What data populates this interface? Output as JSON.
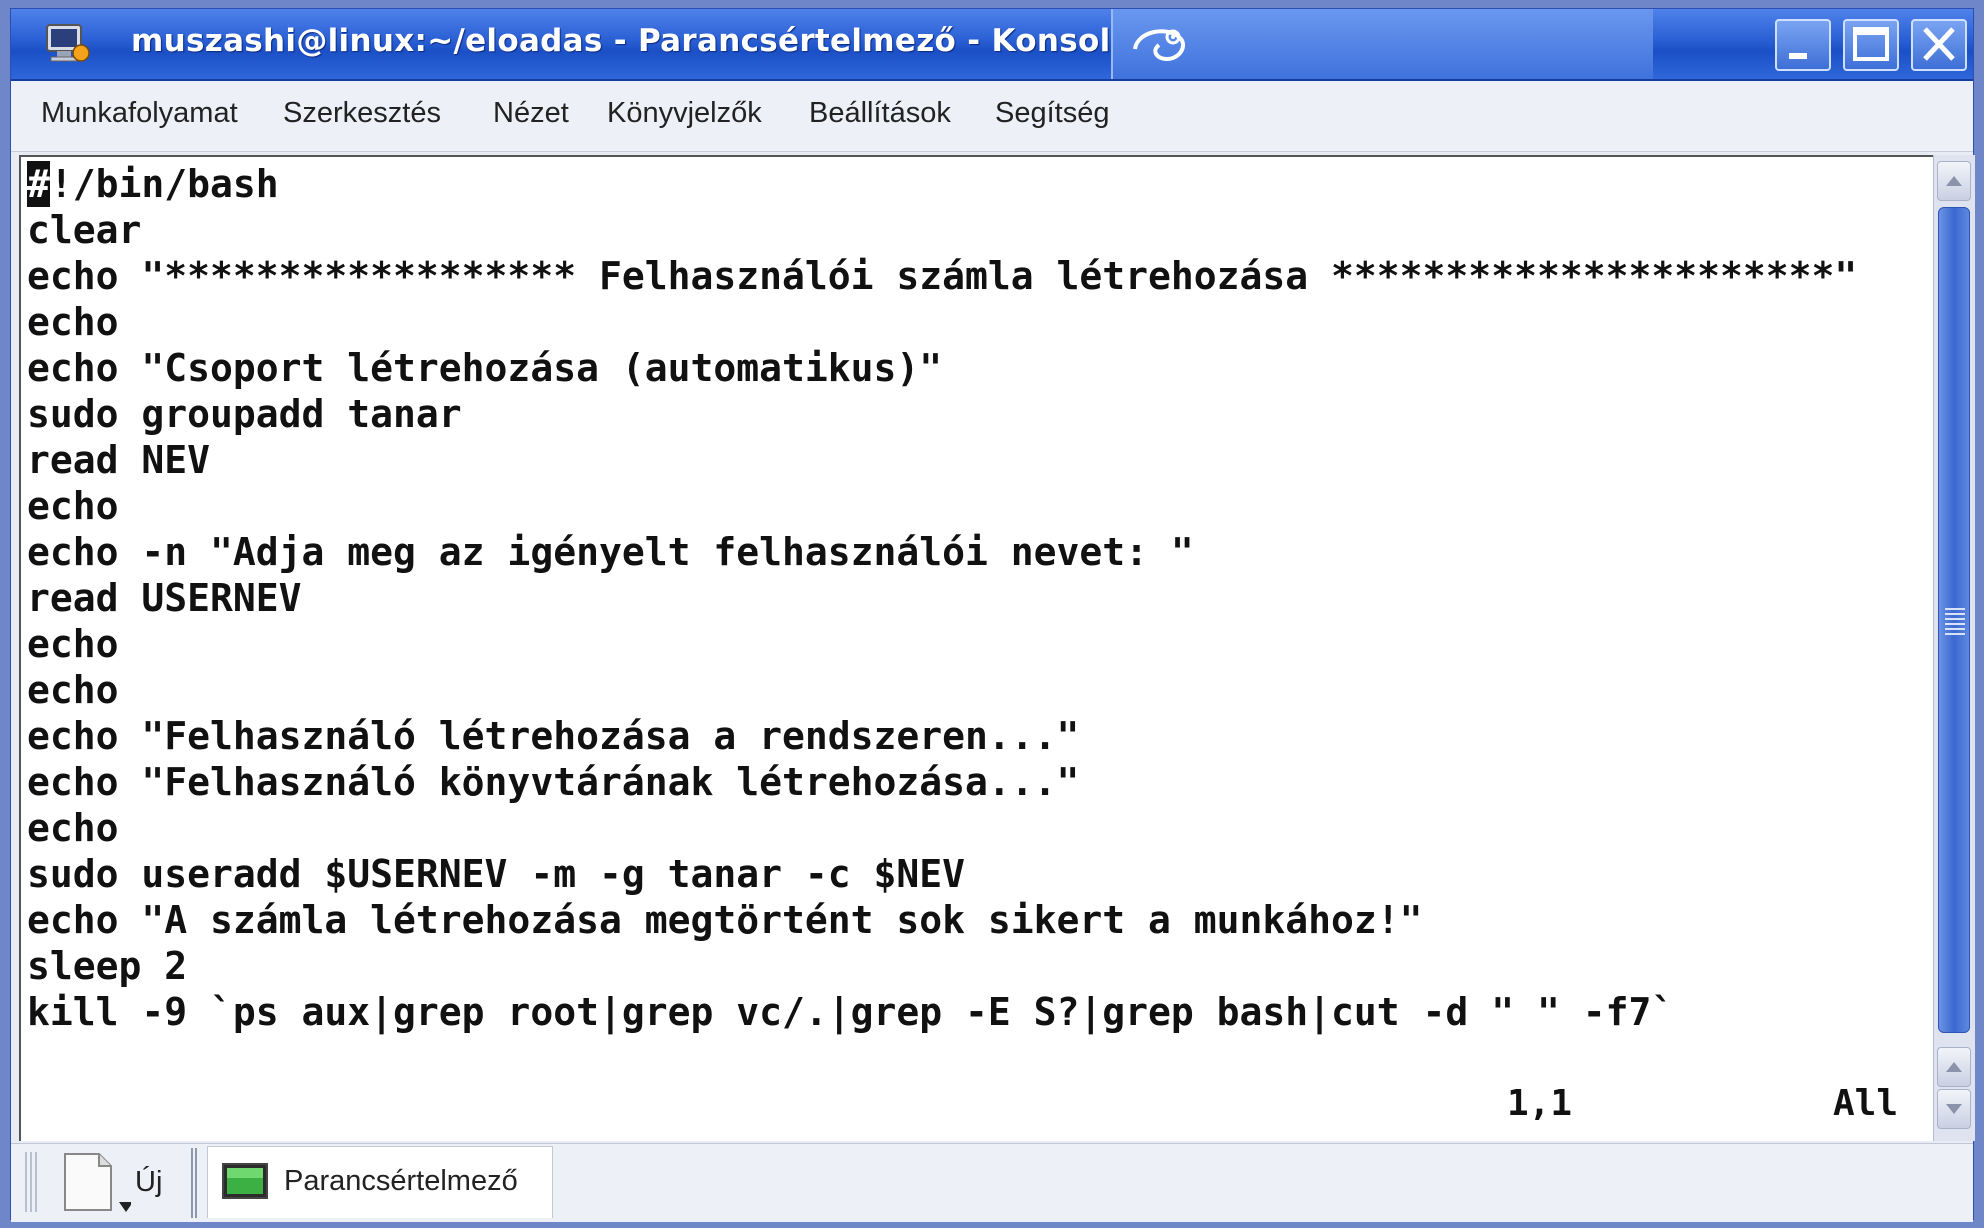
{
  "window": {
    "title": "muszashi@linux:~/eloadas - Parancsértelmező - Konsole"
  },
  "menubar": {
    "items": [
      "Munkafolyamat",
      "Szerkesztés",
      "Nézet",
      "Könyvjelzők",
      "Beállítások",
      "Segítség"
    ]
  },
  "terminal": {
    "cursor_char": "#",
    "first_line_rest": "!/bin/bash",
    "lines": [
      "clear",
      "echo \"****************** Felhasználói számla létrehozása **********************\"",
      "echo",
      "echo \"Csoport létrehozása (automatikus)\"",
      "sudo groupadd tanar",
      "read NEV",
      "echo",
      "echo -n \"Adja meg az igényelt felhasználói nevet: \"",
      "read USERNEV",
      "echo",
      "echo",
      "echo \"Felhasználó létrehozása a rendszeren...\"",
      "echo \"Felhasználó könyvtárának létrehozása...\"",
      "echo",
      "sudo useradd $USERNEV -m -g tanar -c $NEV",
      "echo \"A számla létrehozása megtörtént sok sikert a munkához!\"",
      "sleep 2",
      "kill -9 `ps aux|grep root|grep vc/.|grep -E S?|grep bash|cut -d \" \" -f7`"
    ],
    "status_position": "1,1",
    "status_view": "All"
  },
  "tabbar": {
    "new_label": "Új",
    "session_label": "Parancsértelmező"
  },
  "colors": {
    "title_bar": "#2a5fd4",
    "terminal_bg": "#ffffff",
    "terminal_fg": "#111111",
    "scroll_thumb": "#3c68cf"
  },
  "icons": {
    "app": "konsole-icon",
    "title_logo": "suse-chameleon-icon",
    "minimize": "minimize-icon",
    "maximize": "maximize-icon",
    "close": "close-icon",
    "new_tab": "new-document-icon",
    "session": "terminal-icon"
  }
}
